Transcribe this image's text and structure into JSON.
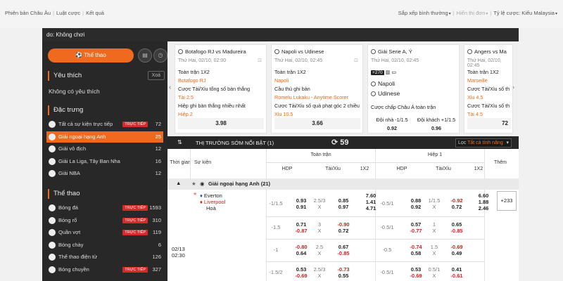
{
  "topbar": {
    "links": [
      "Phiên bản Châu Âu",
      "Luật cược",
      "Kết quả"
    ],
    "sort": "Sắp xếp bình thường",
    "display": "Hiển thị đơn",
    "odds": "Tỷ lệ cược: Kiểu Malaysia"
  },
  "darkbar": {
    "text": "do: Không chơi"
  },
  "sidebar": {
    "main_tab": "Thể thao",
    "favorites_title": "Yêu thích",
    "favorites_clear": "Xoá",
    "favorites_empty": "Không có yêu thích",
    "featured_title": "Đặc trưng",
    "featured": [
      {
        "label": "Tất cả sự kiện trực tiếp",
        "count": "72",
        "live": "TRỰC TIẾP"
      },
      {
        "label": "Giải ngoại hạng Anh",
        "count": "25",
        "live": ""
      },
      {
        "label": "Giải vô địch",
        "count": "12",
        "live": ""
      },
      {
        "label": "Giải La Liga, Tây Ban Nha",
        "count": "16",
        "live": ""
      },
      {
        "label": "Giải NBA",
        "count": "12",
        "live": ""
      }
    ],
    "sports_title": "Thể thao",
    "sports": [
      {
        "label": "Bóng đá",
        "count": "1593",
        "live": "TRỰC TIẾP"
      },
      {
        "label": "Bóng rổ",
        "count": "310",
        "live": "TRỰC TIẾP"
      },
      {
        "label": "Quần vợt",
        "count": "119",
        "live": "TRỰC TIẾP"
      },
      {
        "label": "Bóng chày",
        "count": "6",
        "live": ""
      },
      {
        "label": "Thể thao điện tử",
        "count": "126",
        "live": ""
      },
      {
        "label": "Bóng chuyền",
        "count": "327",
        "live": "TRỰC TIẾP"
      }
    ]
  },
  "cards": [
    {
      "title": "Botafogo RJ vs Madureira",
      "time": "Thứ Hai, 02/10, 02:00",
      "lines": [
        [
          "Toàn trận 1X2",
          ""
        ],
        [
          "Botafogo RJ",
          "o"
        ],
        [
          "Cược Tài/Xỉu tổng số bàn thắng",
          ""
        ],
        [
          "Tài 2.5",
          "o"
        ],
        [
          "Hiệp ghi bàn thắng nhiều nhất",
          ""
        ],
        [
          "Hiệp 2",
          "o"
        ]
      ],
      "price": "3.98"
    },
    {
      "title": "Napoli vs Udinese",
      "time": "Thứ Hai, 02/10, 02:45",
      "lines": [
        [
          "Toàn trận 1X2",
          ""
        ],
        [
          "Napoli",
          "o"
        ],
        [
          "Cầu thủ ghi bàn",
          ""
        ],
        [
          "Romelu Lukaku - Anytime Scorer",
          "o"
        ],
        [
          "Cược Tài/Xỉu số quả phạt góc 2 chiều",
          ""
        ],
        [
          "Xỉu 10.5",
          "o"
        ]
      ],
      "price": "3.66"
    },
    {
      "title": "Giải Serie A, Ý",
      "time": "Thứ Hai, 02/10, 02:45",
      "badge": "+270",
      "home": "Napoli",
      "away": "Udinese",
      "market": "Cược chấp Châu Á toàn trận",
      "sel1": "Đội nhà -1/1.5",
      "sel2": "Đội khách +1/1.5",
      "p1": "0.92",
      "p2": "0.96"
    },
    {
      "title": "Angers vs Ma",
      "time": "Thứ Hai, 02/10, 02:45",
      "lines": [
        [
          "Toàn trận 1X2",
          ""
        ],
        [
          "Marseille",
          "o"
        ],
        [
          "Cược Tài/Xỉu số th",
          ""
        ],
        [
          "Xỉu 4.5",
          "o"
        ],
        [
          "Cược Tài/Xỉu số th",
          ""
        ],
        [
          "Tài 4.5",
          "o"
        ]
      ],
      "price": "72"
    }
  ],
  "market": {
    "title": "THỊ TRƯỜNG SỚM NỔI BẬT (1)",
    "countdown": "59",
    "filter_prefix": "Lọc",
    "filter_value": "Tất cả tính năng"
  },
  "grid": {
    "headers": {
      "time": "Thời gian",
      "event": "Sự kiện",
      "full": "Toàn trận",
      "half": "Hiệp 1",
      "hdp": "HDP",
      "ou": "Tài/Xỉu",
      "x12": "1X2",
      "more": "Thêm"
    },
    "league": "Giải ngoại hạng Anh (21)",
    "home": "Everton",
    "away": "Liverpool",
    "draw": "Hoà",
    "date": "02/13",
    "clock": "02:30",
    "more_count": "+233",
    "rows": [
      {
        "fh": "-1/1.5",
        "f1": [
          "0.93",
          "0.91"
        ],
        "fo": [
          "2.5/3",
          "X"
        ],
        "f2": [
          "0.85",
          "0.97"
        ],
        "fx": [
          "7.60",
          "1.41",
          "4.71"
        ],
        "hh": "-0.5/1",
        "h1": [
          "0.88",
          "0.92"
        ],
        "ho": [
          "1/1.5",
          "X"
        ],
        "h2": [
          "-0.92",
          "0.72"
        ],
        "hx": [
          "6.60",
          "1.88",
          "2.46"
        ]
      },
      {
        "fh": "-1.5",
        "f1": [
          "0.71",
          "-0.87"
        ],
        "fo": [
          "3",
          "X"
        ],
        "f2": [
          "-0.90",
          "0.72"
        ],
        "hh": "-0.5/1",
        "h1": [
          "0.57",
          "-0.77"
        ],
        "ho": [
          "1",
          "X"
        ],
        "h2": [
          "0.65",
          "-0.85"
        ]
      },
      {
        "fh": "-1",
        "f1": [
          "-0.80",
          "0.64"
        ],
        "fo": [
          "2.5",
          "X"
        ],
        "f2": [
          "0.67",
          "-0.85"
        ],
        "hh": "-0.5",
        "h1": [
          "-0.74",
          "0.58"
        ],
        "ho": [
          "1.5",
          "X"
        ],
        "h2": [
          "-0.69",
          "0.49"
        ]
      },
      {
        "fh": "-1.5/2",
        "f1": [
          "0.53",
          "-0.69"
        ],
        "fo": [
          "2.5/3",
          "X"
        ],
        "f2": [
          "-0.73",
          "0.55"
        ],
        "hh": "-0.5/1",
        "h1": [
          "0.53",
          "-0.69"
        ],
        "ho": [
          "0.5/1",
          "X"
        ],
        "h2": [
          "0.41",
          "-0.61"
        ]
      }
    ]
  }
}
